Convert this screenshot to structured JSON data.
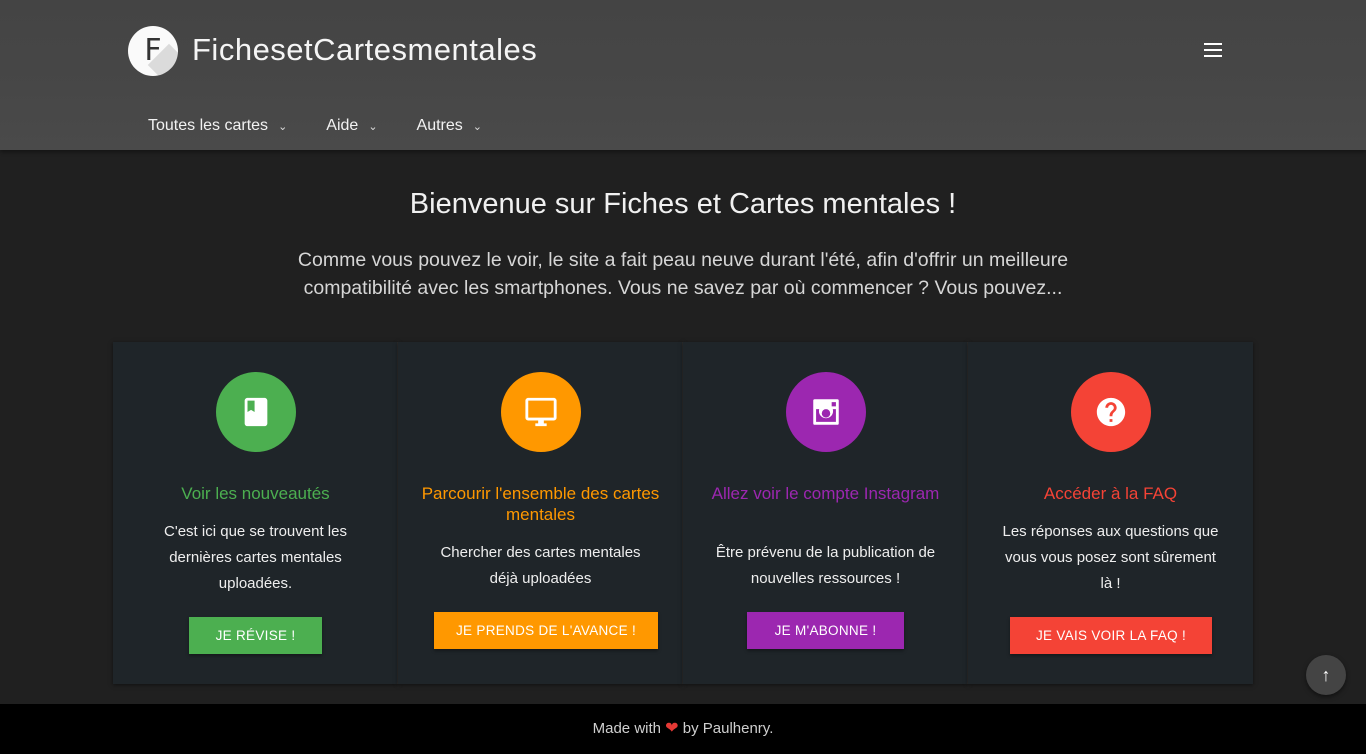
{
  "header": {
    "logo_letter": "F",
    "site_title": "FichesetCartesmentales",
    "menu_icon": "hamburger-menu-icon",
    "nav": [
      {
        "label": "Toutes les cartes",
        "icon": "chevron-down-icon"
      },
      {
        "label": "Aide",
        "icon": "chevron-down-icon"
      },
      {
        "label": "Autres",
        "icon": "chevron-down-icon"
      }
    ]
  },
  "hero": {
    "title": "Bienvenue sur Fiches et Cartes mentales !",
    "subtitle": "Comme vous pouvez le voir, le site a fait peau neuve durant l'été, afin d'offrir un meilleure compatibilité avec les smartphones. Vous ne savez par où commencer ? Vous pouvez..."
  },
  "cards": [
    {
      "icon": "book-icon",
      "color": "#4caf50",
      "title": "Voir les nouveautés",
      "text": "C'est ici que se trouvent les dernières cartes mentales uploadées.",
      "button": "Je révise !"
    },
    {
      "icon": "desktop-icon",
      "color": "#ff9800",
      "title": "Parcourir l'ensemble des cartes mentales",
      "text": "Chercher des cartes mentales déjà uploadées",
      "button": "Je prends de l'avance !"
    },
    {
      "icon": "instagram-icon",
      "color": "#9c27b0",
      "title": "Allez voir le compte Instagram",
      "text": "Être prévenu de la publication de nouvelles ressources !",
      "button": "Je m'abonne !"
    },
    {
      "icon": "help-circle-icon",
      "color": "#f44336",
      "title": "Accéder à la FAQ",
      "text": "Les réponses aux questions que vous vous posez sont sûrement là !",
      "button": "Je vais voir la FAQ !"
    }
  ],
  "scroll_top_icon": "arrow-up-icon",
  "footer": {
    "prefix": "Made with",
    "heart_icon": "heart-icon",
    "suffix": "by Paulhenry."
  }
}
